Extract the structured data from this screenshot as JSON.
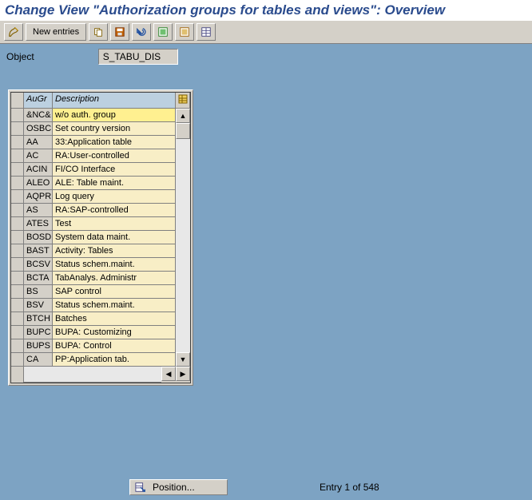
{
  "title": "Change View \"Authorization groups for tables and views\": Overview",
  "toolbar": {
    "new_entries": "New entries"
  },
  "object": {
    "label": "Object",
    "value": "S_TABU_DIS"
  },
  "columns": {
    "augr": "AuGr",
    "desc": "Description"
  },
  "rows": [
    {
      "code": "&NC&",
      "desc": "w/o auth. group",
      "hl": true
    },
    {
      "code": "OSBC",
      "desc": "Set country version"
    },
    {
      "code": "AA",
      "desc": "33:Application table"
    },
    {
      "code": "AC",
      "desc": "RA:User-controlled"
    },
    {
      "code": "ACIN",
      "desc": "FI/CO Interface"
    },
    {
      "code": "ALEO",
      "desc": "ALE: Table maint."
    },
    {
      "code": "AQPR",
      "desc": "Log query"
    },
    {
      "code": "AS",
      "desc": "RA:SAP-controlled"
    },
    {
      "code": "ATES",
      "desc": "Test"
    },
    {
      "code": "BOSD",
      "desc": "System data maint."
    },
    {
      "code": "BAST",
      "desc": "Activity: Tables"
    },
    {
      "code": "BCSV",
      "desc": "Status schem.maint."
    },
    {
      "code": "BCTA",
      "desc": "TabAnalys. Administr"
    },
    {
      "code": "BS",
      "desc": "SAP control"
    },
    {
      "code": "BSV",
      "desc": "Status schem.maint."
    },
    {
      "code": "BTCH",
      "desc": "Batches"
    },
    {
      "code": "BUPC",
      "desc": "BUPA: Customizing"
    },
    {
      "code": "BUPS",
      "desc": "BUPA: Control"
    },
    {
      "code": "CA",
      "desc": "PP:Application tab."
    }
  ],
  "position_label": "Position...",
  "entry_status": "Entry 1 of 548"
}
